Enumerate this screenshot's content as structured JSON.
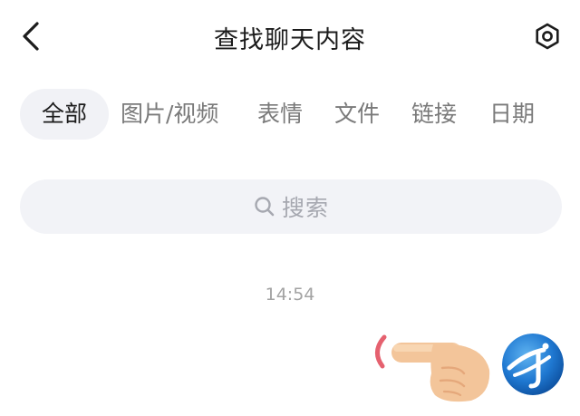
{
  "header": {
    "title": "查找聊天内容",
    "back_icon": "chevron-left-icon",
    "settings_icon": "hexagon-settings-icon"
  },
  "tabs": [
    {
      "label": "全部",
      "active": true
    },
    {
      "label": "图片/视频",
      "active": false
    },
    {
      "label": "表情",
      "active": false
    },
    {
      "label": "文件",
      "active": false
    },
    {
      "label": "链接",
      "active": false
    },
    {
      "label": "日期",
      "active": false
    }
  ],
  "search": {
    "placeholder": "搜索",
    "icon": "search-icon"
  },
  "chat": {
    "timestamp": "14:54",
    "message": {
      "type": "emoji",
      "emoji": "pointing-hand-emoji"
    },
    "avatar": {
      "icon": "blue-globe-logo"
    }
  },
  "colors": {
    "tab_active_bg": "#f1f2f6",
    "search_bg": "#f2f3f7",
    "text_primary": "#1c1c1c",
    "text_secondary": "#7a7a7a",
    "avatar_blue": "#1f78d1"
  }
}
